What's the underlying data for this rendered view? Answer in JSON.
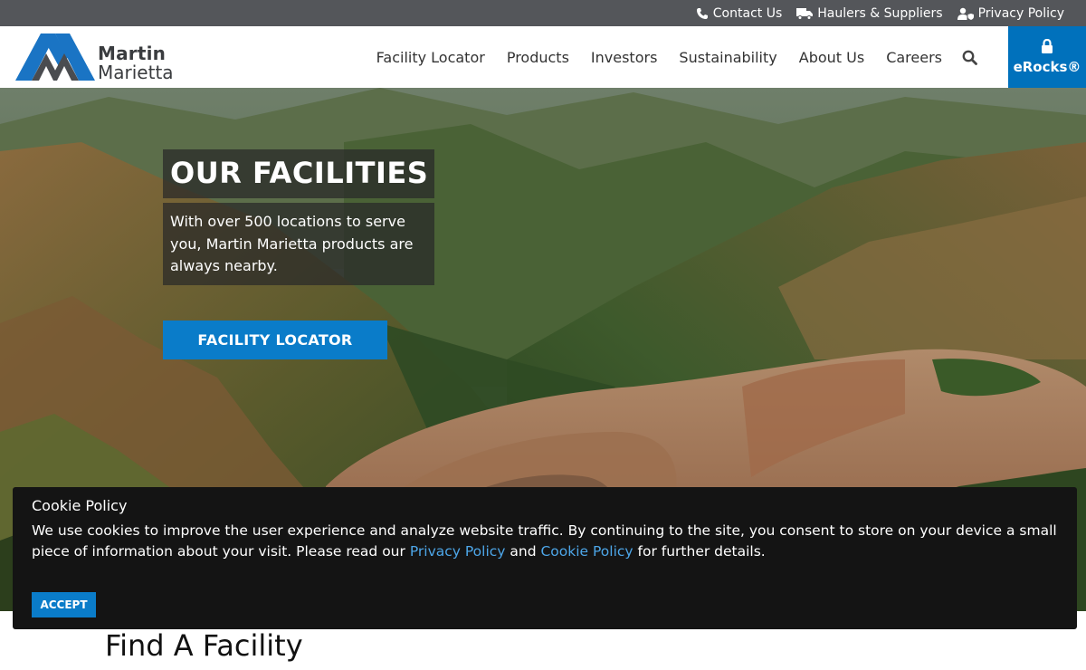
{
  "utility": {
    "contact": "Contact Us",
    "haulers": "Haulers & Suppliers",
    "privacy": "Privacy Policy"
  },
  "logo": {
    "line1": "Martin",
    "line2": "Marietta"
  },
  "nav": {
    "items": [
      "Facility Locator",
      "Products",
      "Investors",
      "Sustainability",
      "About Us",
      "Careers"
    ],
    "search_icon": "search-icon",
    "erocks_label": "eRocks®"
  },
  "hero": {
    "title": "OUR FACILITIES",
    "text": "With over 500 locations to serve you, Martin Marietta products are always nearby.",
    "button": "FACILITY LOCATOR"
  },
  "cookie": {
    "title": "Cookie Policy",
    "text_before": "We use cookies to improve the user experience and analyze website traffic. By continuing to the site, you consent to store on your device a small piece of information about your visit. Please read our ",
    "link1": "Privacy Policy",
    "text_between": " and ",
    "link2": "Cookie Policy",
    "text_after": " for further details.",
    "accept": "ACCEPT"
  },
  "section": {
    "title": "Find A Facility"
  },
  "colors": {
    "utility_bar": "#54565a",
    "brand_blue": "#0071bc",
    "button_blue": "#0a7cc9",
    "cookie_bg": "#141414",
    "cookie_link": "#4da6e8"
  }
}
